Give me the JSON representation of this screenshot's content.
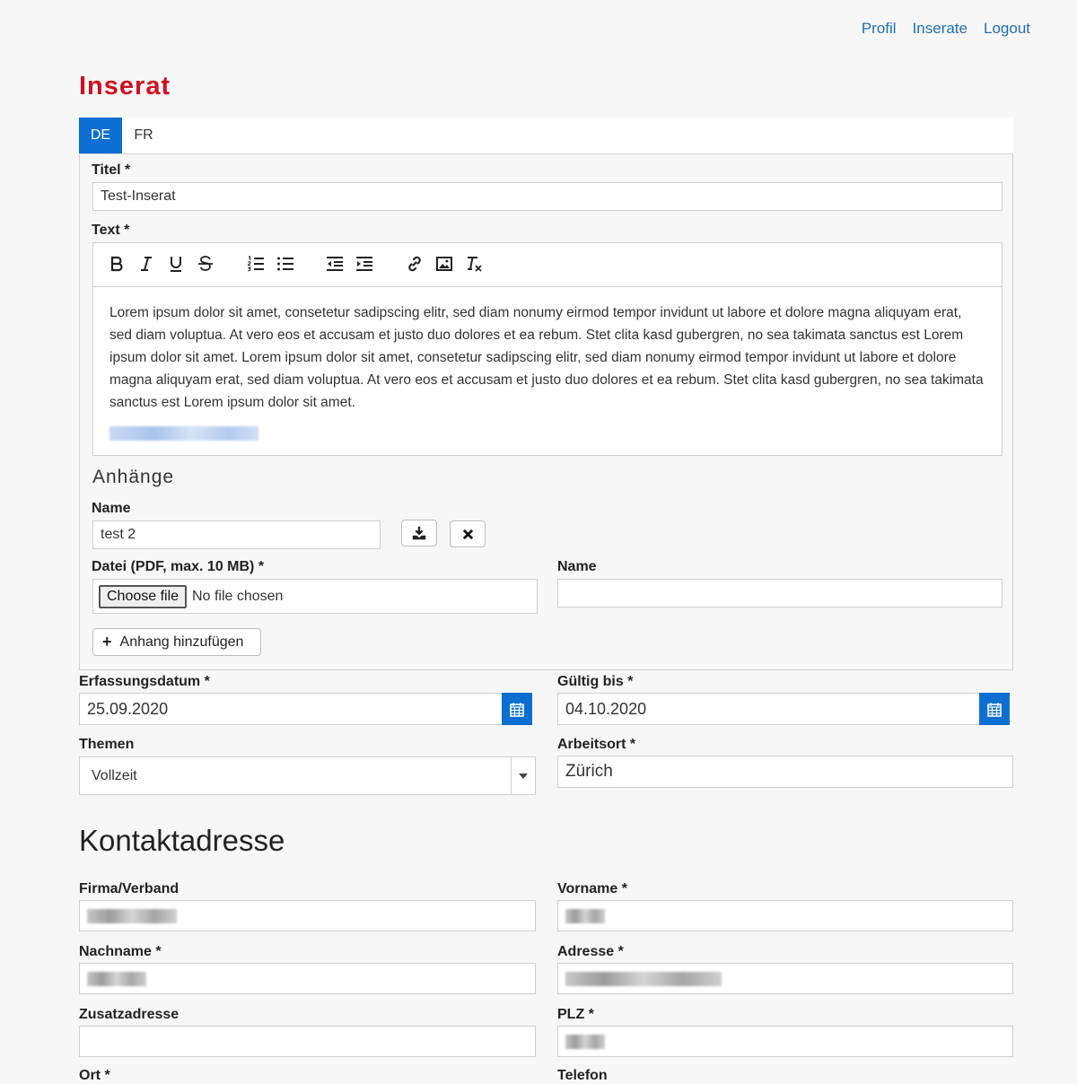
{
  "nav": {
    "profil": "Profil",
    "inserate": "Inserate",
    "logout": "Logout"
  },
  "page_title": "Inserat",
  "tabs": [
    {
      "label": "DE",
      "active": true
    },
    {
      "label": "FR",
      "active": false
    }
  ],
  "form": {
    "titel_label": "Titel *",
    "titel_value": "Test-Inserat",
    "text_label": "Text *",
    "toolbar": [
      "bold-icon",
      "italic-icon",
      "underline-icon",
      "strikethrough-icon",
      "ordered-list-icon",
      "bullet-list-icon",
      "outdent-icon",
      "indent-icon",
      "link-icon",
      "image-icon",
      "clear-format-icon"
    ],
    "text_body": "Lorem ipsum dolor sit amet, consetetur sadipscing elitr, sed diam nonumy eirmod tempor invidunt ut labore et dolore magna aliquyam erat, sed diam voluptua. At vero eos et accusam et justo duo dolores et ea rebum. Stet clita kasd gubergren, no sea takimata sanctus est Lorem ipsum dolor sit amet. Lorem ipsum dolor sit amet, consetetur sadipscing elitr, sed diam nonumy eirmod tempor invidunt ut labore et dolore magna aliquyam erat, sed diam voluptua. At vero eos et accusam et justo duo dolores et ea rebum. Stet clita kasd gubergren, no sea takimata sanctus est Lorem ipsum dolor sit amet."
  },
  "attachments": {
    "heading": "Anhänge",
    "name_label": "Name",
    "name_value": "test 2",
    "file_label": "Datei (PDF, max. 10 MB) *",
    "choose_file": "Choose file",
    "no_file": "No file chosen",
    "name2_label": "Name",
    "name2_value": "",
    "add_button": "Anhang hinzufügen"
  },
  "dates": {
    "erfassung_label": "Erfassungsdatum *",
    "erfassung_value": "25.09.2020",
    "gueltig_label": "Gültig bis *",
    "gueltig_value": "04.10.2020"
  },
  "themen": {
    "label": "Themen",
    "value": "Vollzeit"
  },
  "arbeitsort": {
    "label": "Arbeitsort *",
    "value": "Zürich"
  },
  "contact": {
    "heading": "Kontaktadresse",
    "firma_label": "Firma/Verband",
    "vorname_label": "Vorname *",
    "nachname_label": "Nachname *",
    "adresse_label": "Adresse *",
    "zusatz_label": "Zusatzadresse",
    "plz_label": "PLZ *",
    "ort_label": "Ort *",
    "telefon_label": "Telefon"
  },
  "colors": {
    "brand_red": "#d0101f",
    "primary_blue": "#0c6fd1",
    "link_blue": "#1f6fb5"
  }
}
